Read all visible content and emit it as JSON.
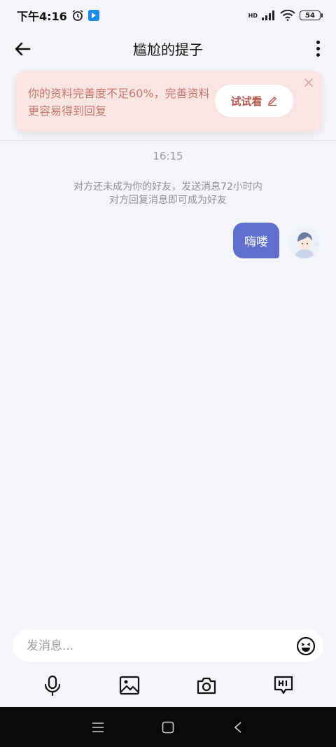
{
  "status": {
    "time": "下午4:16",
    "battery": "54",
    "hd": "HD"
  },
  "header": {
    "title": "尴尬的提子"
  },
  "banner": {
    "text": "你的资料完善度不足60%，完善资料更容易得到回复",
    "button_label": "试试看"
  },
  "chat": {
    "timestamp": "16:15",
    "system_note_line1": "对方还未成为你的好友，发送消息72小时内",
    "system_note_line2": "对方回复消息即可成为好友",
    "messages": [
      {
        "text": "嗨喽",
        "from": "me"
      }
    ]
  },
  "input": {
    "placeholder": "发消息..."
  },
  "colors": {
    "bubble": "#5f6fcf",
    "banner_bg": "#f9e6e3",
    "banner_text": "#c8746c",
    "background": "#f4f5f9"
  },
  "icons": [
    "back-arrow-icon",
    "more-vertical-icon",
    "close-icon",
    "pencil-icon",
    "emoji-icon",
    "microphone-icon",
    "image-icon",
    "camera-icon",
    "hi-icon"
  ]
}
